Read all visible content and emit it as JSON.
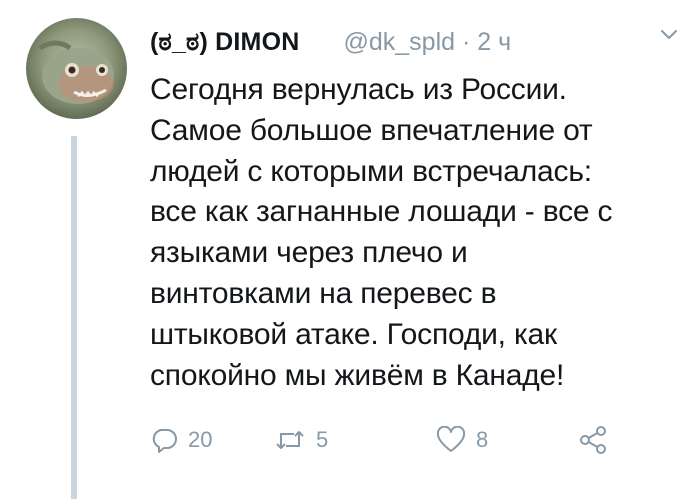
{
  "tweet": {
    "display_name": "(ಠ_ಠ) DIMON",
    "handle_time": "@dk_spld · 2 ч",
    "text": "Сегодня вернулась из России.\nСамое большое впечатление от\nлюдей с которыми встречалась:\nвсе как загнанные лошади - все с\nязыками через плечо и\nвинтовками на перевес в\nштыковой атаке. Господи, как\nспокойно мы живём в Канаде!",
    "replies": "20",
    "retweets": "5",
    "likes": "8"
  },
  "icons": {
    "reply": "reply-icon",
    "retweet": "retweet-icon",
    "like": "heart-icon",
    "share": "share-icon",
    "menu": "chevron-down-icon",
    "avatar": "piranha-avatar"
  },
  "colors": {
    "text": "#14171a",
    "muted": "#8899a6",
    "thread_line": "#c9d4dd"
  }
}
